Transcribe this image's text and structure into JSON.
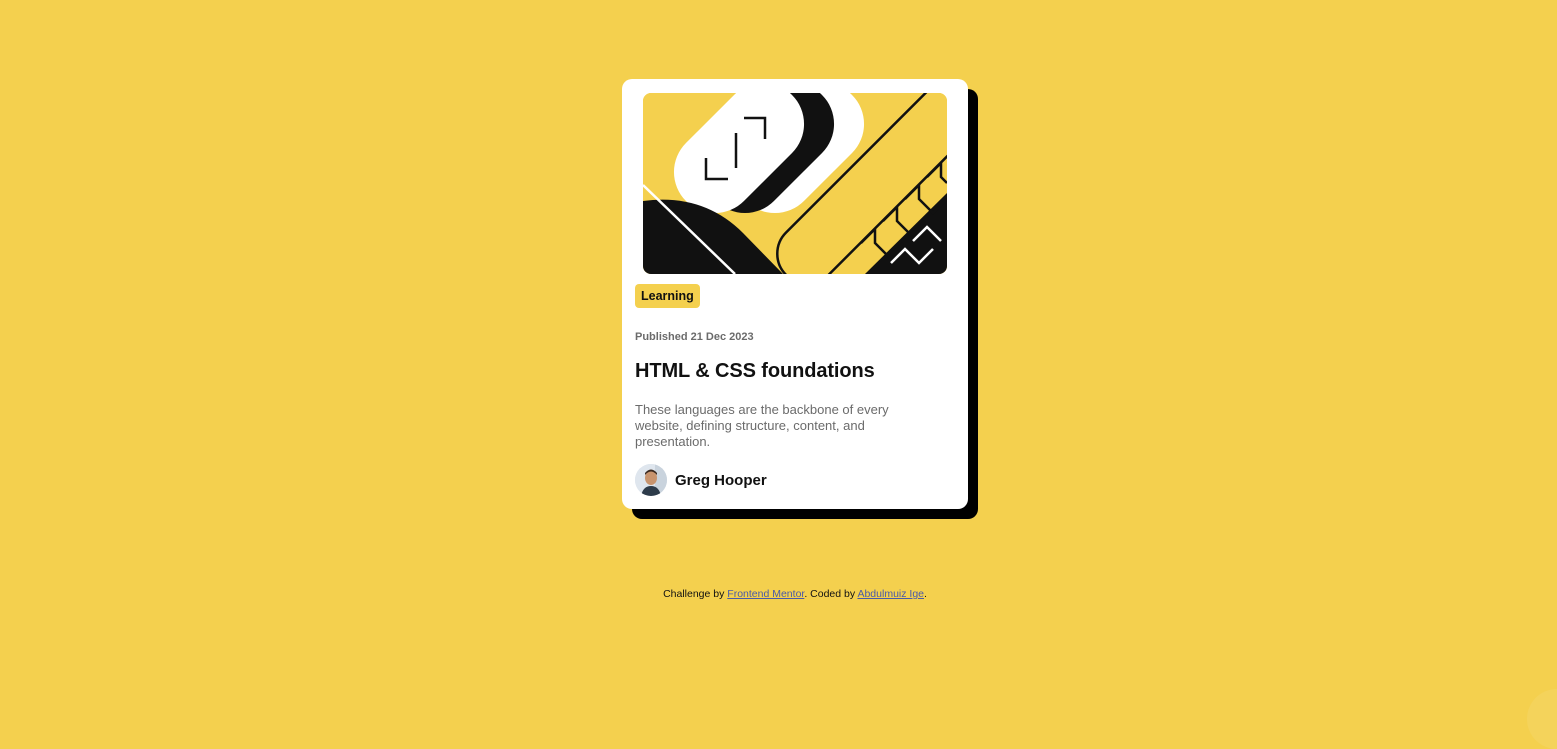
{
  "card": {
    "tag": "Learning",
    "published": "Published 21 Dec 2023",
    "title": "HTML & CSS foundations",
    "description": "These languages are the backbone of every website, defining structure, content, and presentation.",
    "author": {
      "name": "Greg Hooper"
    },
    "illustration_icon": "abstract-shapes-illustration"
  },
  "attribution": {
    "prefix": "Challenge by",
    "link1": "Frontend Mentor",
    "middle": ". Coded by",
    "link2": "Abdulmuiz Ige",
    "suffix": "."
  },
  "colors": {
    "background": "#F4D04E",
    "card": "#FFFFFF",
    "shadow": "#000000",
    "text": "#111111",
    "muted": "#6B6B6B"
  }
}
